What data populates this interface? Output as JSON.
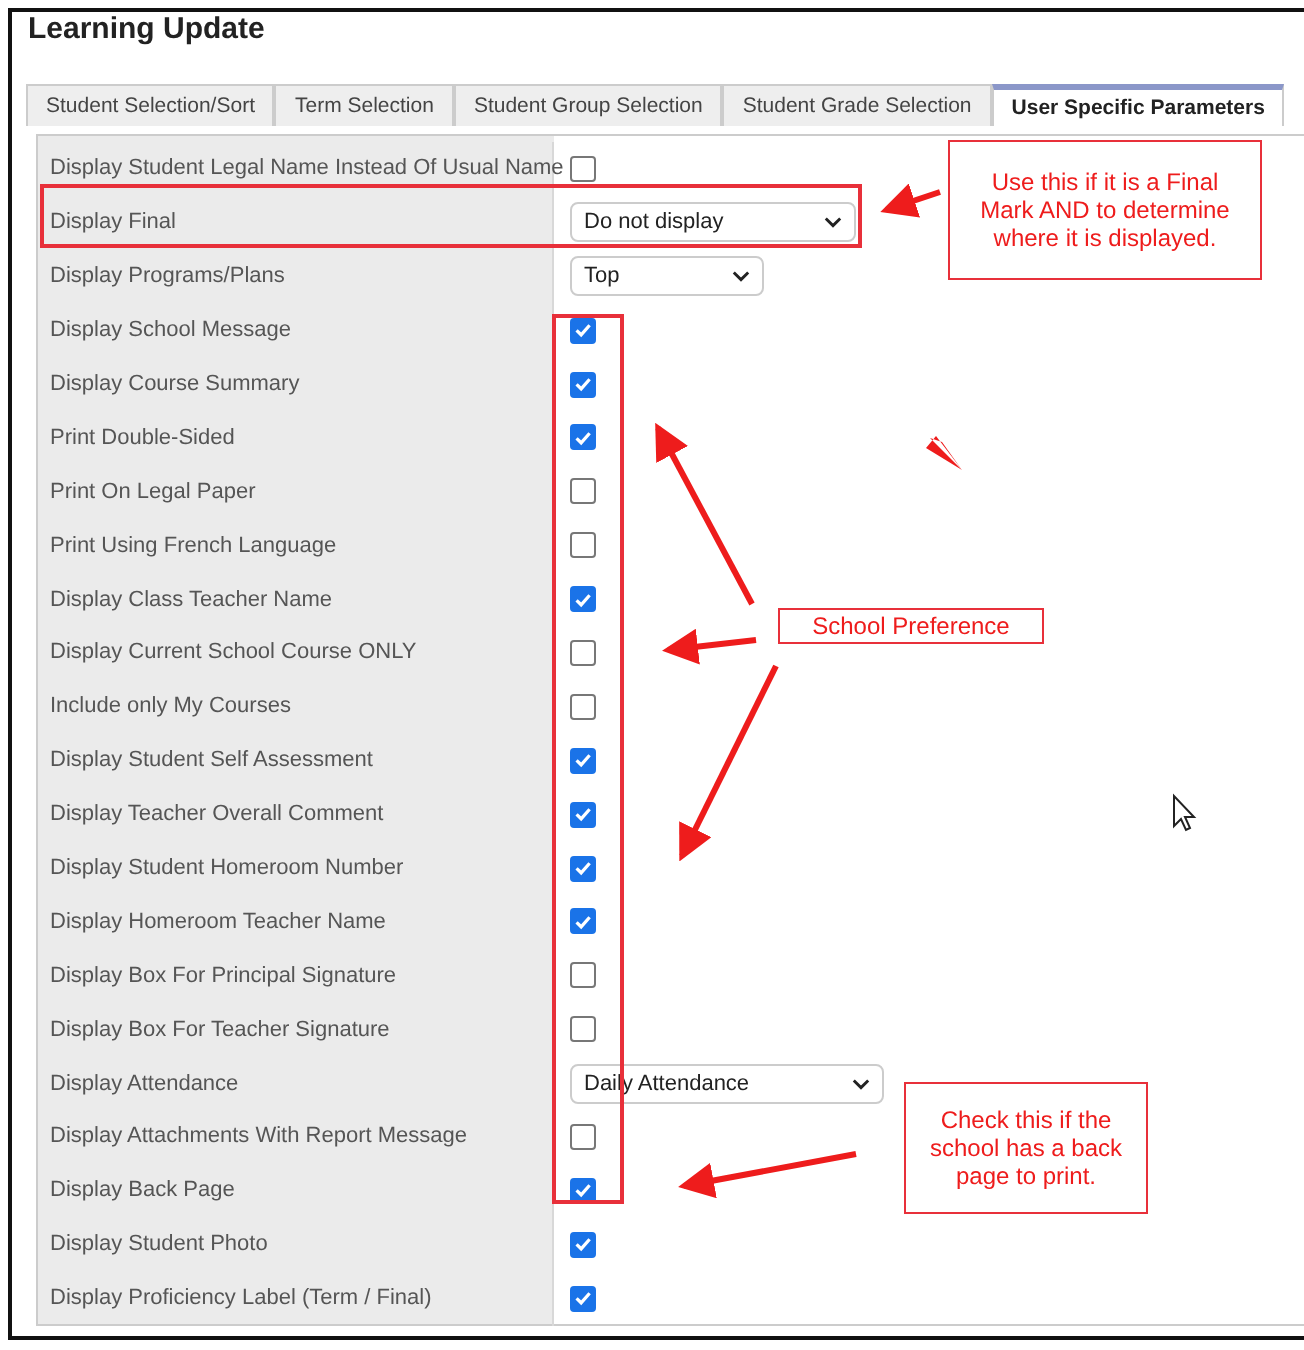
{
  "window": {
    "title": "Learning Update"
  },
  "tabs": [
    {
      "label": "Student Selection/Sort",
      "selected": false
    },
    {
      "label": "Term Selection",
      "selected": false
    },
    {
      "label": "Student Group Selection",
      "selected": false
    },
    {
      "label": "Student Grade Selection",
      "selected": false
    },
    {
      "label": "User Specific Parameters",
      "selected": true
    }
  ],
  "parameters": [
    {
      "label": "Display Student Legal Name Instead Of Usual Name",
      "kind": "checkbox",
      "checked": false
    },
    {
      "label": "Display Final",
      "kind": "select",
      "value": "Do not display"
    },
    {
      "label": "Display Programs/Plans",
      "kind": "select",
      "value": "Top"
    },
    {
      "label": "Display School Message",
      "kind": "checkbox",
      "checked": true
    },
    {
      "label": "Display Course Summary",
      "kind": "checkbox",
      "checked": true
    },
    {
      "label": "Print Double-Sided",
      "kind": "checkbox",
      "checked": true
    },
    {
      "label": "Print On Legal Paper",
      "kind": "checkbox",
      "checked": false
    },
    {
      "label": "Print Using French Language",
      "kind": "checkbox",
      "checked": false
    },
    {
      "label": "Display Class Teacher Name",
      "kind": "checkbox",
      "checked": true
    },
    {
      "label": "Display Current School Course ONLY",
      "kind": "checkbox",
      "checked": false
    },
    {
      "label": "Include only My Courses",
      "kind": "checkbox",
      "checked": false
    },
    {
      "label": "Display Student Self Assessment",
      "kind": "checkbox",
      "checked": true
    },
    {
      "label": "Display Teacher Overall Comment",
      "kind": "checkbox",
      "checked": true
    },
    {
      "label": "Display Student Homeroom Number",
      "kind": "checkbox",
      "checked": true
    },
    {
      "label": "Display Homeroom Teacher Name",
      "kind": "checkbox",
      "checked": true
    },
    {
      "label": "Display Box For Principal Signature",
      "kind": "checkbox",
      "checked": false
    },
    {
      "label": "Display Box For Teacher Signature",
      "kind": "checkbox",
      "checked": false
    },
    {
      "label": "Display Attendance",
      "kind": "select",
      "value": "Daily Attendance"
    },
    {
      "label": "Display Attachments With Report Message",
      "kind": "checkbox",
      "checked": false
    },
    {
      "label": "Display Back Page",
      "kind": "checkbox",
      "checked": true
    },
    {
      "label": "Display Student Photo",
      "kind": "checkbox",
      "checked": true
    },
    {
      "label": "Display Proficiency Label (Term / Final)",
      "kind": "checkbox",
      "checked": true
    }
  ],
  "annotations": [
    {
      "text": "Use this if it is a Final Mark AND to determine where it is displayed.",
      "kind": "final"
    },
    {
      "text": "School Preference",
      "kind": "school"
    },
    {
      "text": "Check this if the school has a back page to print.",
      "kind": "back"
    }
  ]
}
